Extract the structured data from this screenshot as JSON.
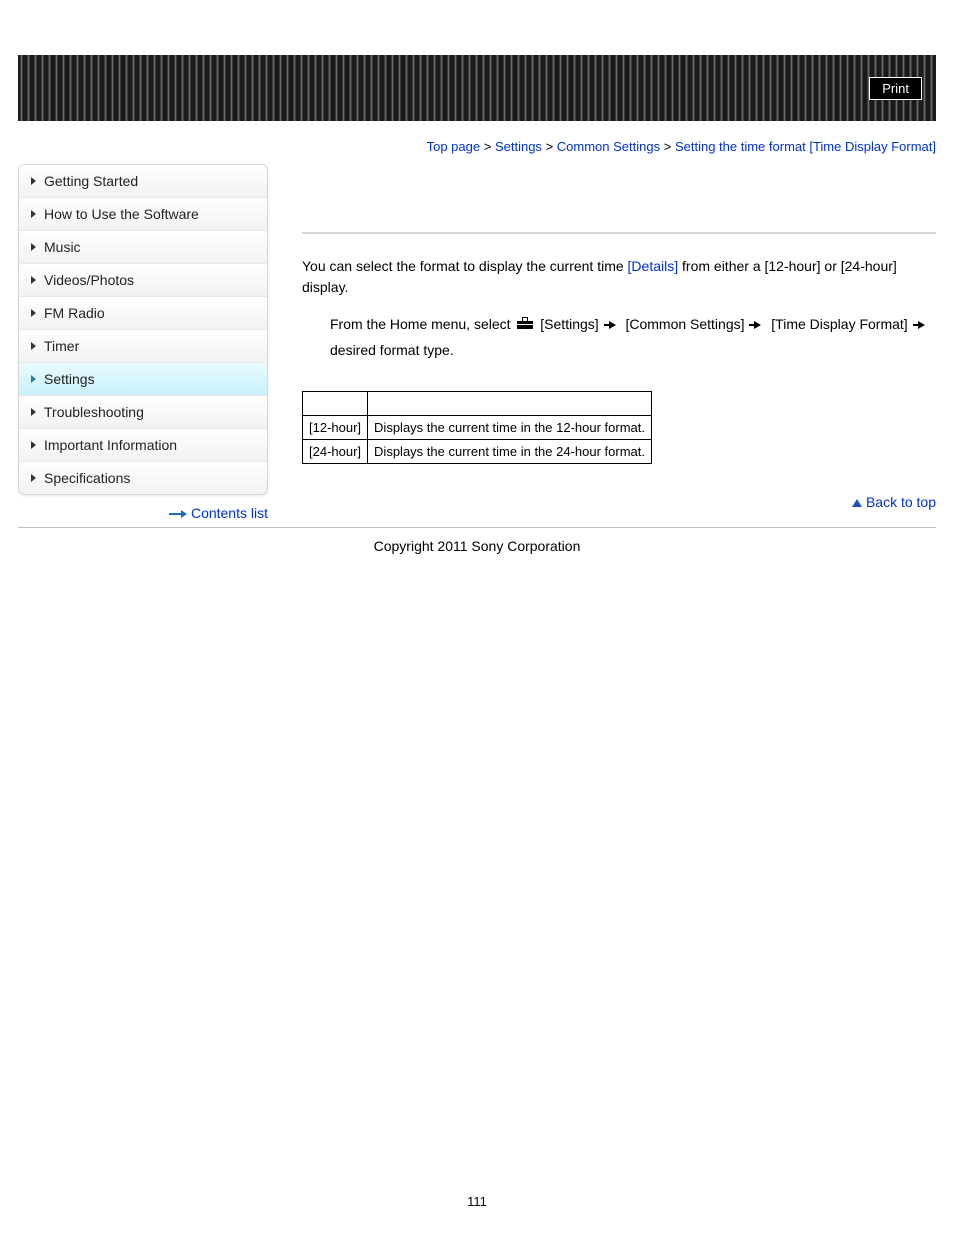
{
  "header": {
    "print_label": "Print"
  },
  "breadcrumb": {
    "top": "Top page",
    "settings": "Settings",
    "common": "Common Settings",
    "current": "Setting the time format [Time Display Format]",
    "sep": ">"
  },
  "sidebar": {
    "items": [
      {
        "label": "Getting Started",
        "selected": false
      },
      {
        "label": "How to Use the Software",
        "selected": false
      },
      {
        "label": "Music",
        "selected": false
      },
      {
        "label": "Videos/Photos",
        "selected": false
      },
      {
        "label": "FM Radio",
        "selected": false
      },
      {
        "label": "Timer",
        "selected": false
      },
      {
        "label": "Settings",
        "selected": true
      },
      {
        "label": "Troubleshooting",
        "selected": false
      },
      {
        "label": "Important Information",
        "selected": false
      },
      {
        "label": "Specifications",
        "selected": false
      }
    ],
    "contents_list": "Contents list"
  },
  "content": {
    "intro_pre": "You can select the format to display the current time ",
    "details_link": "[Details]",
    "intro_post": " from either a [12-hour] or [24-hour] display.",
    "step_pre": "From the Home menu, select ",
    "step_settings": "[Settings]",
    "step_common": "[Common Settings]",
    "step_time": "[Time Display Format]",
    "step_tail": "desired format type.",
    "table": {
      "rows": [
        {
          "k": "[12-hour]",
          "v": "Displays the current time in the 12-hour format."
        },
        {
          "k": "[24-hour]",
          "v": "Displays the current time in the 24-hour format."
        }
      ]
    },
    "back_to_top": "Back to top"
  },
  "footer": {
    "copyright": "Copyright 2011 Sony Corporation",
    "page_number": "111"
  }
}
